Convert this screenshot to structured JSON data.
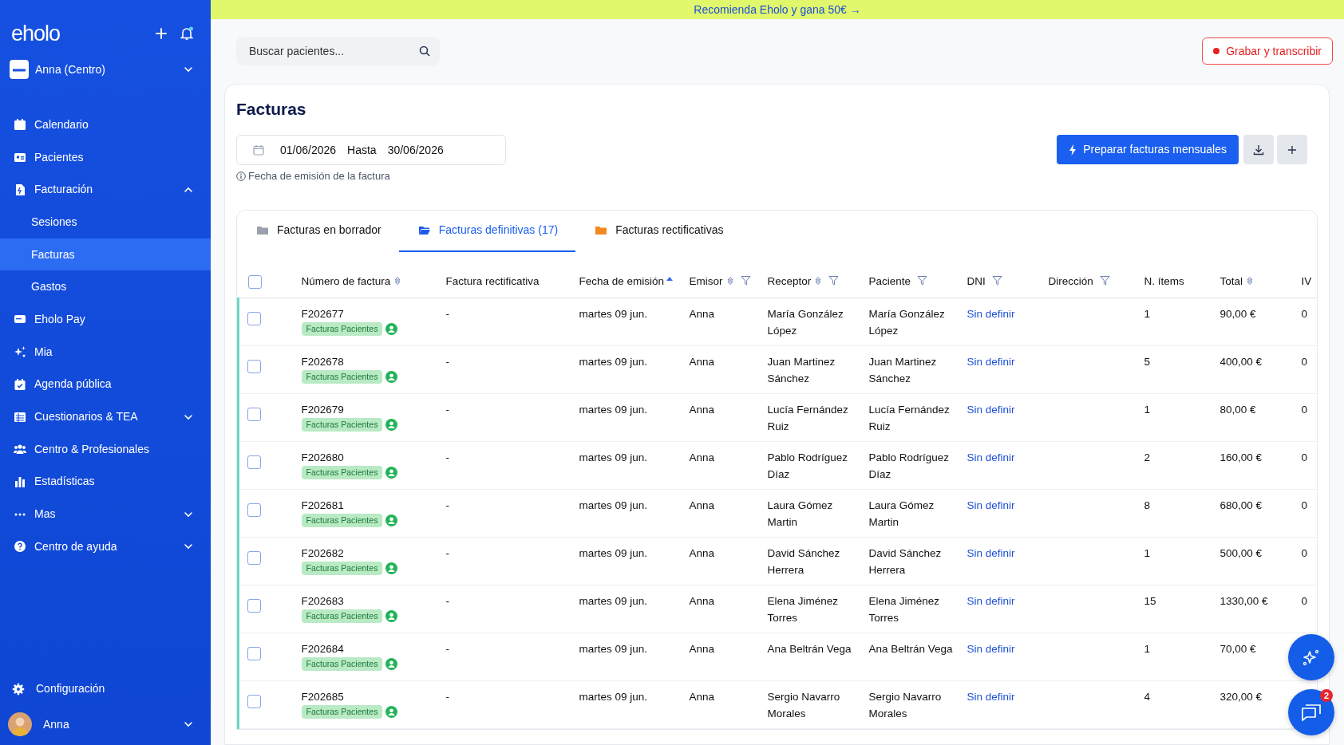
{
  "banner": {
    "text": "Recomienda Eholo y gana 50€ →"
  },
  "sidebar": {
    "logo": "eholo",
    "center": "Anna (Centro)",
    "items": [
      {
        "label": "Calendario",
        "selected": false
      },
      {
        "label": "Pacientes",
        "selected": false
      },
      {
        "label": "Facturación",
        "selected": false,
        "expanded": true,
        "children": [
          {
            "label": "Sesiones",
            "selected": false
          },
          {
            "label": "Facturas",
            "selected": true
          },
          {
            "label": "Gastos",
            "selected": false
          }
        ]
      },
      {
        "label": "Eholo Pay",
        "selected": false
      },
      {
        "label": "Mia",
        "selected": false
      },
      {
        "label": "Agenda pública",
        "selected": false
      },
      {
        "label": "Cuestionarios & TEA",
        "selected": false,
        "expanded": false
      },
      {
        "label": "Centro & Profesionales",
        "selected": false
      },
      {
        "label": "Estadísticas",
        "selected": false
      },
      {
        "label": "Mas",
        "selected": false,
        "expanded": false
      },
      {
        "label": "Centro de ayuda",
        "selected": false,
        "expanded": false
      }
    ],
    "settings": "Configuración",
    "user": "Anna"
  },
  "header": {
    "search": {
      "placeholder": "Buscar pacientes..."
    },
    "record_button": "Grabar y transcribir"
  },
  "page": {
    "title": "Facturas",
    "date_from": "01/06/2026",
    "date_to_label": "Hasta",
    "date_to": "30/06/2026",
    "hint": "Fecha de emisión de la factura",
    "primary_button": "Preparar facturas mensuales"
  },
  "tabs": [
    {
      "label": "Facturas en borrador",
      "selected": false,
      "color": "#9aa0ad"
    },
    {
      "label": "Facturas definitivas (17)",
      "selected": true,
      "color": "#1e5ce6"
    },
    {
      "label": "Facturas rectificativas",
      "selected": false,
      "color": "#f5871f"
    }
  ],
  "table": {
    "select_all_checked": false,
    "columns": [
      {
        "label": "Número de factura",
        "sortable": true
      },
      {
        "label": "Factura rectificativa"
      },
      {
        "label": "Fecha de emisión",
        "sorted": true
      },
      {
        "label": "Emisor",
        "sortable": true,
        "filter": true
      },
      {
        "label": "Receptor",
        "sortable": true,
        "filter": true
      },
      {
        "label": "Paciente",
        "filter": true
      },
      {
        "label": "DNI",
        "filter": true
      },
      {
        "label": "Dirección",
        "filter": true
      },
      {
        "label": "N. ítems"
      },
      {
        "label": "Total",
        "sortable": true
      },
      {
        "label": "IV"
      }
    ],
    "rows": [
      {
        "checked": false,
        "number": "F202677",
        "tag": "Facturas Pacientes",
        "rectificativa": "-",
        "date": "martes 09 jun.",
        "emisor": "Anna",
        "receptor": "María González López",
        "paciente": "María González López",
        "dni": "Sin definir",
        "items": "1",
        "total": "90,00 €",
        "iva": "0"
      },
      {
        "checked": false,
        "number": "F202678",
        "tag": "Facturas Pacientes",
        "rectificativa": "-",
        "date": "martes 09 jun.",
        "emisor": "Anna",
        "receptor": "Juan Martinez Sánchez",
        "paciente": "Juan Martinez Sánchez",
        "dni": "Sin definir",
        "items": "5",
        "total": "400,00 €",
        "iva": "0"
      },
      {
        "checked": false,
        "number": "F202679",
        "tag": "Facturas Pacientes",
        "rectificativa": "-",
        "date": "martes 09 jun.",
        "emisor": "Anna",
        "receptor": "Lucía Fernández Ruiz",
        "paciente": "Lucía Fernández Ruiz",
        "dni": "Sin definir",
        "items": "1",
        "total": "80,00 €",
        "iva": "0"
      },
      {
        "checked": false,
        "number": "F202680",
        "tag": "Facturas Pacientes",
        "rectificativa": "-",
        "date": "martes 09 jun.",
        "emisor": "Anna",
        "receptor": "Pablo Rodríguez Díaz",
        "paciente": "Pablo Rodríguez Díaz",
        "dni": "Sin definir",
        "items": "2",
        "total": "160,00 €",
        "iva": "0"
      },
      {
        "checked": false,
        "number": "F202681",
        "tag": "Facturas Pacientes",
        "rectificativa": "-",
        "date": "martes 09 jun.",
        "emisor": "Anna",
        "receptor": "Laura Gómez Martin",
        "paciente": "Laura Gómez Martin",
        "dni": "Sin definir",
        "items": "8",
        "total": "680,00 €",
        "iva": "0"
      },
      {
        "checked": false,
        "number": "F202682",
        "tag": "Facturas Pacientes",
        "rectificativa": "-",
        "date": "martes 09 jun.",
        "emisor": "Anna",
        "receptor": "David Sánchez Herrera",
        "paciente": "David Sánchez Herrera",
        "dni": "Sin definir",
        "items": "1",
        "total": "500,00 €",
        "iva": "0"
      },
      {
        "checked": false,
        "number": "F202683",
        "tag": "Facturas Pacientes",
        "rectificativa": "-",
        "date": "martes 09 jun.",
        "emisor": "Anna",
        "receptor": "Elena Jiménez Torres",
        "paciente": "Elena Jiménez Torres",
        "dni": "Sin definir",
        "items": "15",
        "total": "1330,00 €",
        "iva": "0"
      },
      {
        "checked": false,
        "number": "F202684",
        "tag": "Facturas Pacientes",
        "rectificativa": "-",
        "date": "martes 09 jun.",
        "emisor": "Anna",
        "receptor": "Ana Beltrán Vega",
        "paciente": "Ana Beltrán Vega",
        "dni": "Sin definir",
        "items": "1",
        "total": "70,00 €"
      },
      {
        "checked": false,
        "number": "F202685",
        "tag": "Facturas Pacientes",
        "rectificativa": "-",
        "date": "martes 09 jun.",
        "emisor": "Anna",
        "receptor": "Sergio Navarro Morales",
        "paciente": "Sergio Navarro Morales",
        "dni": "Sin definir",
        "items": "4",
        "total": "320,00 €"
      }
    ]
  },
  "chat_badge": "2"
}
